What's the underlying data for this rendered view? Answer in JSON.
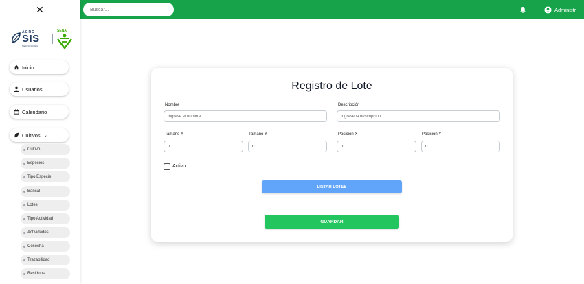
{
  "colors": {
    "topbar": "#16a34a",
    "save_button": "#22c55e",
    "list_button": "#60a5fa",
    "logo_blue": "#1e3a5f",
    "sena_green": "#39a900"
  },
  "sidebar": {
    "close_icon": "close-icon",
    "logos": {
      "agro_top": "AGRO",
      "agro_main": "SIS",
      "agro_bottom": "TECNOLOGIA",
      "sena": "SENA"
    },
    "items": [
      {
        "label": "Inicio",
        "icon": "home-icon"
      },
      {
        "label": "Usuarios",
        "icon": "user-icon"
      },
      {
        "label": "Calendario",
        "icon": "calendar-icon"
      },
      {
        "label": "Cultivos",
        "icon": "plant-icon",
        "expanded": true
      }
    ],
    "subitems": [
      "Cultivo",
      "Especies",
      "Tipo Especie",
      "Bancal",
      "Lotes",
      "Tipo Actividad",
      "Actividades",
      "Cosecha",
      "Trazabilidad",
      "Residuos"
    ]
  },
  "header": {
    "search_placeholder": "Buscar...",
    "bell_icon": "bell-icon",
    "user_label": "Administr"
  },
  "form": {
    "title": "Registro de Lote",
    "nombre": {
      "label": "Nombre",
      "placeholder": "Ingrese el nombre"
    },
    "descripcion": {
      "label": "Descripción",
      "placeholder": "Ingrese la descripción"
    },
    "tamano_x": {
      "label": "Tamaño X",
      "value": "0"
    },
    "tamano_y": {
      "label": "Tamaño Y",
      "value": "0"
    },
    "posicion_x": {
      "label": "Posición X",
      "value": "0"
    },
    "posicion_y": {
      "label": "Posición Y",
      "value": "0"
    },
    "activo_label": "Activo",
    "activo_checked": false,
    "list_button": "LISTAR LOTES",
    "save_button": "GUARDAR"
  }
}
